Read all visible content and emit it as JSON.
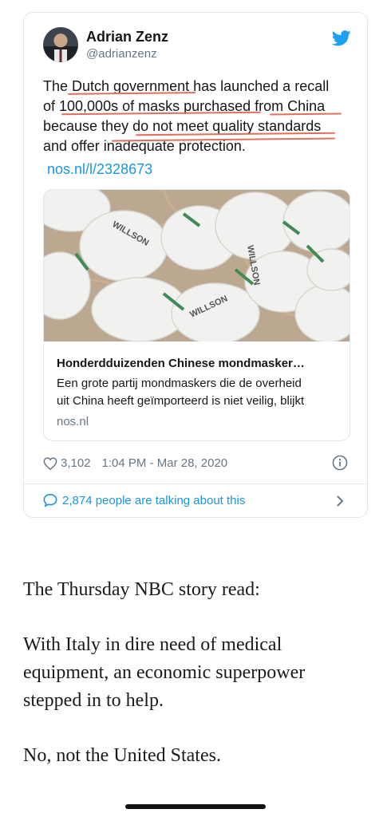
{
  "tweet": {
    "author_name": "Adrian Zenz",
    "author_handle": "@adrianzenz",
    "text_lines": [
      "The Dutch government has launched a recall",
      "of 100,000s of masks purchased from China",
      "because they do not meet quality standards",
      "and offer inadequate protection."
    ],
    "link_text": "nos.nl/l/2328673",
    "card": {
      "title": "Honderdduizenden Chinese mondmasker…",
      "description_line1": "Een grote partij mondmaskers die de overheid",
      "description_line2": "uit China heeft geïmporteerd is niet veilig, blijkt",
      "domain": "nos.nl",
      "image_labels": [
        "WILLSON",
        "WILLSON",
        "WILLSON"
      ]
    },
    "likes": "3,102",
    "timestamp": "1:04 PM - Mar 28, 2020",
    "talking": "2,874 people are talking about this",
    "accent_color": "#1b95e0",
    "annotation_color": "#e0705a"
  },
  "article": {
    "paragraphs": [
      "The Thursday NBC story read:",
      "With Italy in dire need of medical equipment, an economic superpower stepped in to help.",
      "No, not the United States."
    ]
  }
}
